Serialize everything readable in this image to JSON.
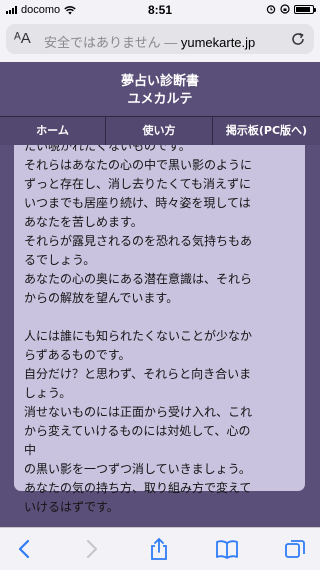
{
  "status": {
    "carrier": "docomo",
    "time": "8:51",
    "battery_level": 0.85
  },
  "browser": {
    "aa_label": "AA",
    "security_text": "安全ではありません — ",
    "domain": "yumekarte.jp"
  },
  "header": {
    "title": "夢占い診断書",
    "subtitle": "ユメカルテ"
  },
  "nav": {
    "items": [
      {
        "label": "ホーム"
      },
      {
        "label": "使い方"
      },
      {
        "label": "掲示板(PC版へ)"
      }
    ]
  },
  "content": {
    "paragraph1": "たい覗かれたくないものです。\nそれらはあなたの心の中で黒い影のように\nずっと存在し、消し去りたくても消えずに\nいつまでも居座り続け、時々姿を現しては\nあなたを苦しめます。\nそれらが露見されるのを恐れる気持ちもあ\nるでしょう。\nあなたの心の奥にある潜在意識は、それら\nからの解放を望んでいます。",
    "paragraph2": "人には誰にも知られたくないことが少なか\nらずあるものです。\n自分だけ？と思わず、それらと向き合いま\nしょう。\n消せないものには正面から受け入れ、これ\nから変えていけるものには対処して、心の\n中\nの黒い影を一つずつ消していきましょう。\nあなたの気の持ち方、取り組み方で変えて\nいけるはずです。"
  },
  "icons": {
    "back": "chevron-left-icon",
    "forward": "chevron-right-icon",
    "share": "share-icon",
    "bookmarks": "book-icon",
    "tabs": "tabs-icon"
  },
  "colors": {
    "accent": "#2f7cf6",
    "header_bg": "#5a4f78",
    "card_bg": "#c9c3df"
  }
}
